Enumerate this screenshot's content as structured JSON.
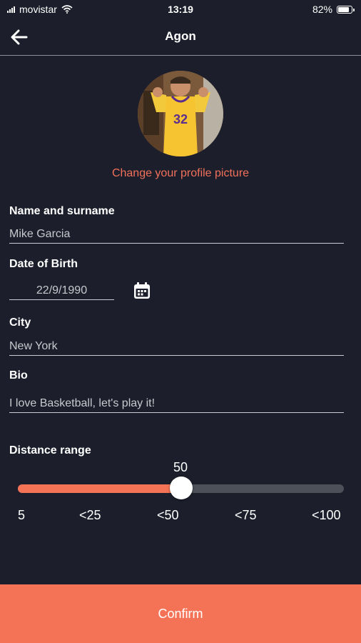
{
  "status_bar": {
    "carrier": "movistar",
    "time": "13:19",
    "battery_text": "82%",
    "battery_level": 0.82
  },
  "header": {
    "title": "Agon",
    "back_icon": "arrow-left-icon"
  },
  "profile": {
    "change_picture_label": "Change your profile picture",
    "change_picture_color": "#f2705a"
  },
  "form": {
    "name": {
      "label": "Name and surname",
      "value": "Mike Garcia"
    },
    "dob": {
      "label": "Date of Birth",
      "value": "22/9/1990",
      "icon": "calendar-icon"
    },
    "city": {
      "label": "City",
      "value": "New York"
    },
    "bio": {
      "label": "Bio",
      "value": "I love Basketball, let's play it!"
    }
  },
  "distance": {
    "label": "Distance range",
    "value": "50",
    "fraction": 0.5,
    "ticks": [
      "5",
      "<25",
      "<50",
      "<75",
      "<100"
    ]
  },
  "confirm": {
    "label": "Confirm"
  },
  "colors": {
    "accent": "#f47356",
    "background": "#1c1f2b",
    "track": "#4d5058"
  }
}
